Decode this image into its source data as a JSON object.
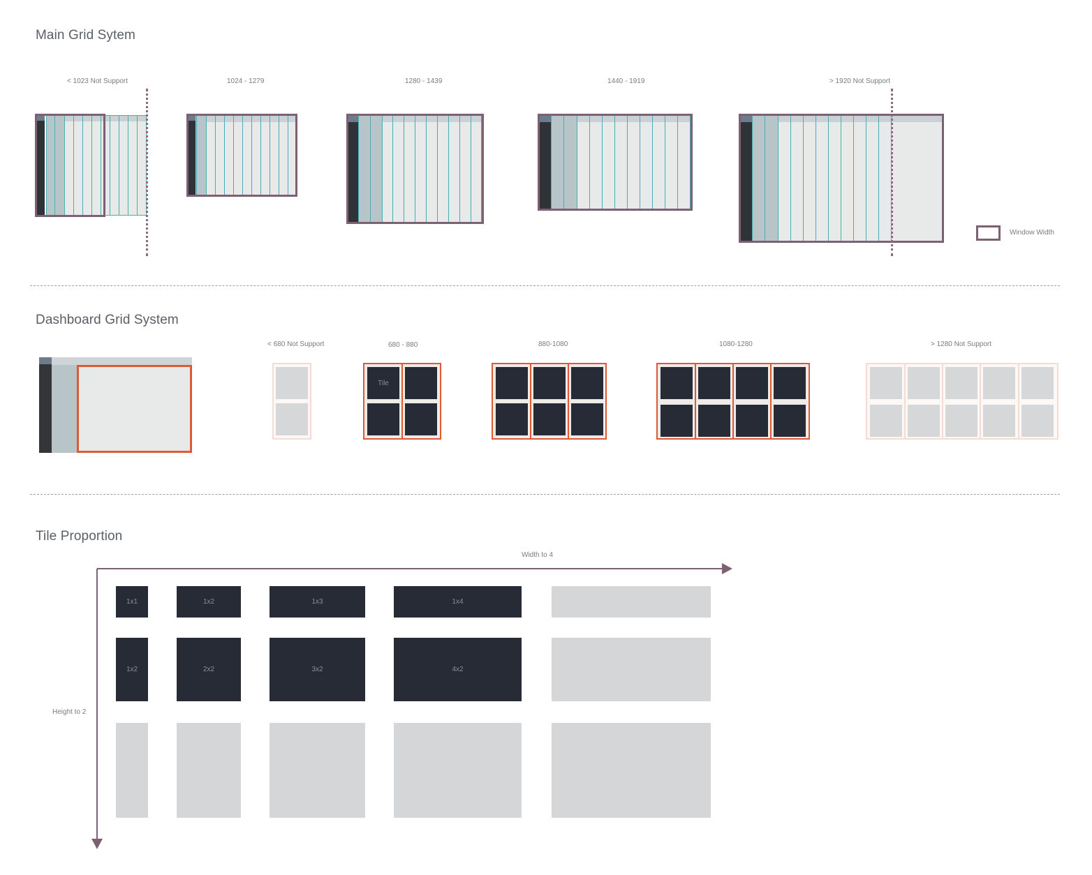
{
  "sections": {
    "main_grid": {
      "title": "Main Grid Sytem",
      "breakpoints": [
        {
          "label": "< 1023   Not Support"
        },
        {
          "label": "1024 - 1279"
        },
        {
          "label": "1280 - 1439"
        },
        {
          "label": "1440 - 1919"
        },
        {
          "label": "> 1920   Not Support"
        }
      ],
      "legend": {
        "label": "Window Width"
      }
    },
    "dashboard_grid": {
      "title": "Dashboard Grid System",
      "breakpoints": [
        {
          "label": "< 680   Not Support"
        },
        {
          "label": "680 - 880"
        },
        {
          "label": "880-1080"
        },
        {
          "label": "1080-1280"
        },
        {
          "label": "> 1280 Not Support"
        }
      ],
      "tile_label": "Tile"
    },
    "tile_proportion": {
      "title": "Tile Proportion",
      "x_axis_label": "Width to 4",
      "y_axis_label": "Height to 2",
      "tiles": {
        "r1c1": "1x1",
        "r1c2": "1x2",
        "r1c3": "1x3",
        "r1c4": "1x4",
        "r2c1": "1x2",
        "r2c2": "2x2",
        "r2c3": "3x2",
        "r2c4": "4x2"
      }
    }
  },
  "colors": {
    "window_border": "#7d6073",
    "grid_column": "#49aeb3",
    "dashboard_frame": "#de5a33",
    "tile_dark": "#272b36",
    "tile_ghost": "#d5d6d8"
  }
}
